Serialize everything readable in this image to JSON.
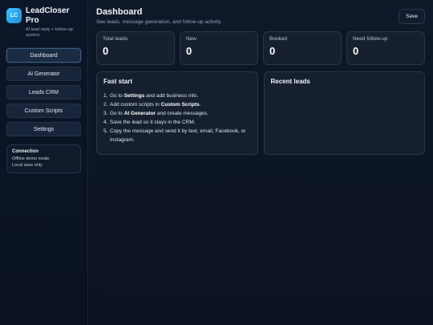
{
  "brand": {
    "logo_text": "LC",
    "name": "LeadCloser Pro",
    "tagline": "AI lead reply + follow-up system"
  },
  "sidebar": {
    "items": [
      {
        "label": "Dashboard",
        "active": true
      },
      {
        "label": "AI Generator",
        "active": false
      },
      {
        "label": "Leads CRM",
        "active": false
      },
      {
        "label": "Custom Scripts",
        "active": false
      },
      {
        "label": "Settings",
        "active": false
      }
    ],
    "connection": {
      "title": "Connection",
      "line1": "Offline demo mode",
      "line2": "Local save only"
    }
  },
  "header": {
    "title": "Dashboard",
    "subtitle": "See leads, message generation, and follow-up activity.",
    "save_label": "Save"
  },
  "stats": [
    {
      "label": "Total leads",
      "value": "0"
    },
    {
      "label": "New",
      "value": "0"
    },
    {
      "label": "Booked",
      "value": "0"
    },
    {
      "label": "Need follow-up",
      "value": "0"
    }
  ],
  "fast_start": {
    "title": "Fast start",
    "steps": [
      {
        "num": "1.",
        "pre": "Go to ",
        "bold": "Settings",
        "post": " and add business info."
      },
      {
        "num": "2.",
        "pre": "Add custom scripts in ",
        "bold": "Custom Scripts",
        "post": "."
      },
      {
        "num": "3.",
        "pre": "Go to ",
        "bold": "AI Generator",
        "post": " and create messages."
      },
      {
        "num": "4.",
        "pre": "Save the lead so it stays in the CRM.",
        "bold": "",
        "post": ""
      },
      {
        "num": "5.",
        "pre": "Copy the message and send it by text, email, Facebook, or Instagram.",
        "bold": "",
        "post": ""
      }
    ]
  },
  "recent_leads": {
    "title": "Recent leads"
  },
  "colors": {
    "accent": "#2ba8ef",
    "background": "#0b1220",
    "card": "#16202f"
  }
}
